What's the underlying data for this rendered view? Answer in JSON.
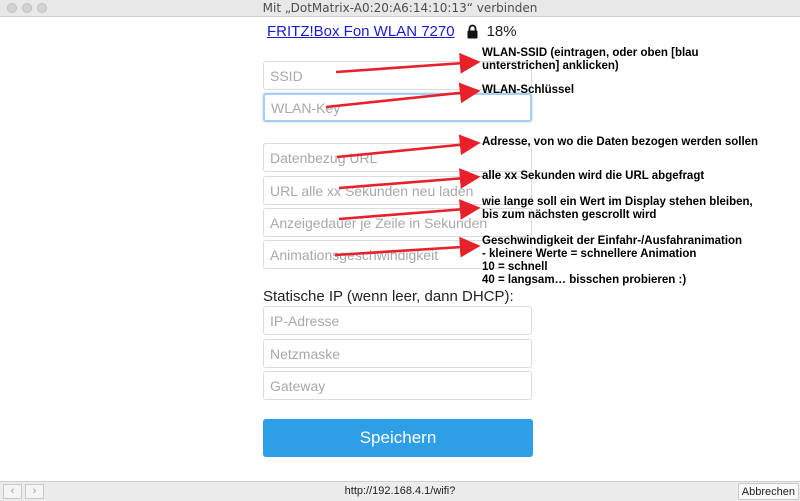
{
  "window": {
    "title": "Mit „DotMatrix-A0:20:A6:14:10:13“ verbinden"
  },
  "network": {
    "name": "FRITZ!Box Fon WLAN 7270",
    "signal": "18%",
    "lock_icon": "lock-icon"
  },
  "form": {
    "ssid_placeholder": "SSID",
    "key_placeholder": "WLAN-Key",
    "url_placeholder": "Datenbezug URL",
    "interval_placeholder": "URL alle xx Sekunden neu laden",
    "display_placeholder": "Anzeigedauer je Zeile in Sekunden",
    "animation_placeholder": "Animationsgeschwindigkeit",
    "static_ip_label": "Statische IP (wenn leer, dann DHCP):",
    "ip_placeholder": "IP-Adresse",
    "netmask_placeholder": "Netzmaske",
    "gateway_placeholder": "Gateway",
    "save_label": "Speichern"
  },
  "annotations": {
    "ssid_1": "WLAN-SSID (eintragen, oder oben [blau",
    "ssid_2": "unterstrichen] anklicken)",
    "key": "WLAN-Schlüssel",
    "url": "Adresse, von wo die Daten bezogen werden sollen",
    "interval": "alle xx Sekunden wird die URL abgefragt",
    "display_1": "wie lange soll ein Wert im Display stehen bleiben,",
    "display_2": "bis zum nächsten gescrollt wird",
    "anim_1": "Geschwindigkeit der Einfahr-/Ausfahranimation",
    "anim_2": "- kleinere Werte = schnellere Animation",
    "anim_3": "10 = schnell",
    "anim_4": "40 = langsam… bisschen probieren :)",
    "arrow_color": "#e8202a"
  },
  "bottombar": {
    "back_icon": "chevron-left-icon",
    "forward_icon": "chevron-right-icon",
    "url": "http://192.168.4.1/wifi?",
    "cancel_label": "Abbrechen"
  }
}
